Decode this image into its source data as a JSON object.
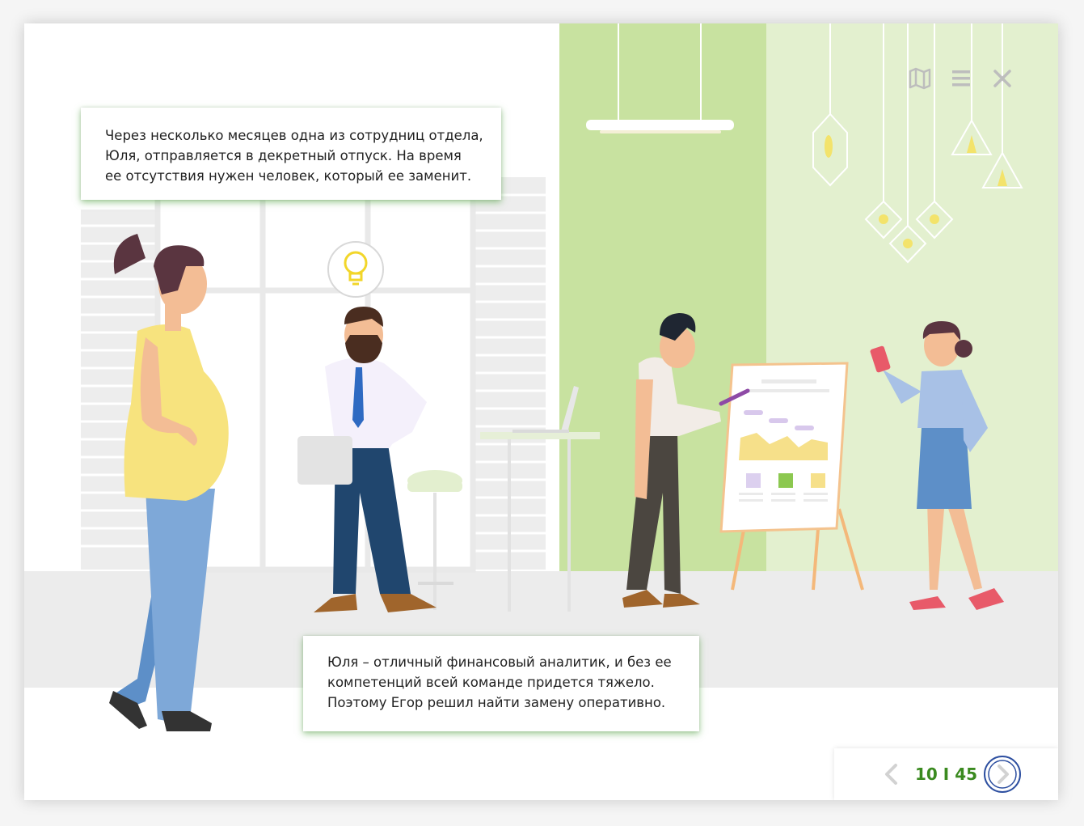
{
  "dialogs": {
    "top": {
      "lines": [
        "Через несколько месяцев одна из сотрудниц отдела,",
        "Юля, отправляется в декретный отпуск. На время",
        "ее отсутствия нужен человек, который ее заменит."
      ]
    },
    "bottom": {
      "lines": [
        "Юля – отличный финансовый аналитик, и без ее",
        "компетенций всей команде придется тяжело.",
        "Поэтому Егор решил найти замену оперативно."
      ]
    }
  },
  "toolbar": {
    "map_icon": "map-icon",
    "menu_icon": "hamburger-menu-icon",
    "close_icon": "close-icon"
  },
  "navigation": {
    "current_page": "10",
    "separator": "I",
    "total_pages": "45",
    "counter_text": "10 I 45",
    "prev_icon": "chevron-left-icon",
    "next_icon": "chevron-right-circle-icon"
  },
  "colors": {
    "accent_green": "#3a8a1f",
    "wall_green": "#c8e2a0",
    "wall_green_light": "#e3f0cf",
    "floor": "#ececec",
    "nav_ring": "#2d4fa0"
  }
}
